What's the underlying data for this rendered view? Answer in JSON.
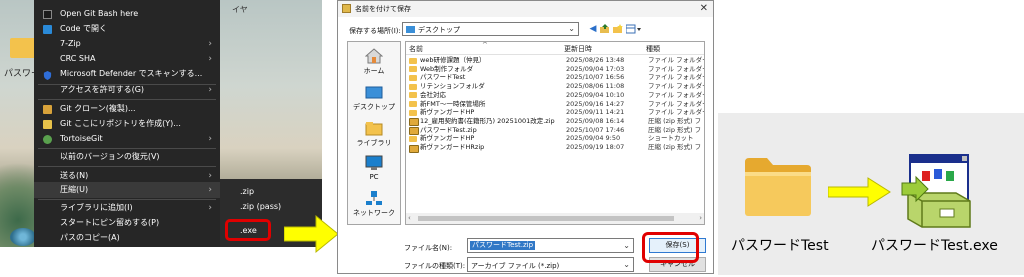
{
  "desktop": {
    "folder_label": "パスワード",
    "top_right_text": "イヤ"
  },
  "context_menu": {
    "items": [
      {
        "label": "Open Git Bash here",
        "icon": "git-bash-icon",
        "arrow": false
      },
      {
        "label": "Code で開く",
        "icon": "vscode-icon",
        "arrow": false
      },
      {
        "label": "7-Zip",
        "icon": "",
        "arrow": true
      },
      {
        "label": "CRC SHA",
        "icon": "",
        "arrow": true
      },
      {
        "label": "Microsoft Defender でスキャンする...",
        "icon": "defender-shield-icon",
        "arrow": false
      },
      {
        "label": "アクセスを許可する(G)",
        "icon": "",
        "arrow": true
      },
      {
        "label": "Git クローン(複製)...",
        "icon": "git-clone-icon",
        "arrow": false
      },
      {
        "label": "Git ここにリポジトリを作成(Y)...",
        "icon": "git-create-icon",
        "arrow": false
      },
      {
        "label": "TortoiseGit",
        "icon": "tortoisegit-icon",
        "arrow": true
      },
      {
        "label": "以前のバージョンの復元(V)",
        "icon": "",
        "arrow": false
      },
      {
        "label": "送る(N)",
        "icon": "",
        "arrow": true
      },
      {
        "label": "圧縮(U)",
        "icon": "",
        "arrow": true
      },
      {
        "label": "ライブラリに追加(I)",
        "icon": "",
        "arrow": true
      },
      {
        "label": "スタートにピン留めする(P)",
        "icon": "",
        "arrow": false
      },
      {
        "label": "パスのコピー(A)",
        "icon": "",
        "arrow": false
      }
    ],
    "submenu": [
      ".zip",
      ".zip (pass)",
      ".exe"
    ]
  },
  "dialog": {
    "title": "名前を付けて保存",
    "save_location_label": "保存する場所(I):",
    "location": "デスクトップ",
    "places": [
      "ホーム",
      "デスクトップ",
      "ライブラリ",
      "PC",
      "ネットワーク"
    ],
    "columns": [
      "名前",
      "更新日時",
      "種類"
    ],
    "files": [
      {
        "name": "web研修課題（仲見）",
        "date": "2025/08/26 13:48",
        "type": "ファイル フォルダー",
        "kind": "folder"
      },
      {
        "name": "Web制作フォルダ",
        "date": "2025/09/04 17:03",
        "type": "ファイル フォルダー",
        "kind": "folder"
      },
      {
        "name": "パスワードTest",
        "date": "2025/10/07 16:56",
        "type": "ファイル フォルダー",
        "kind": "folder"
      },
      {
        "name": "リテンションフォルダ",
        "date": "2025/08/06 11:08",
        "type": "ファイル フォルダー",
        "kind": "folder"
      },
      {
        "name": "会社対応",
        "date": "2025/09/04 10:10",
        "type": "ファイル フォルダー",
        "kind": "folder"
      },
      {
        "name": "新FMT～一時保管場所",
        "date": "2025/09/16 14:27",
        "type": "ファイル フォルダー",
        "kind": "folder"
      },
      {
        "name": "新ヴァンガードHP",
        "date": "2025/09/11 14:21",
        "type": "ファイル フォルダー",
        "kind": "folder"
      },
      {
        "name": "12_雇用契約書(在籍形乃) 20251001改定.zip",
        "date": "2025/09/08 16:14",
        "type": "圧縮 (zip 形式) フ",
        "kind": "zip"
      },
      {
        "name": "パスワードTest.zip",
        "date": "2025/10/07 17:46",
        "type": "圧縮 (zip 形式) フ",
        "kind": "zip"
      },
      {
        "name": "新ヴァンガードHP",
        "date": "2025/09/04 9:50",
        "type": "ショートカット",
        "kind": "shortcut"
      },
      {
        "name": "新ヴァンガードHRzip",
        "date": "2025/09/19 18:07",
        "type": "圧縮 (zip 形式) フ",
        "kind": "zip"
      }
    ],
    "filename_label": "ファイル名(N):",
    "filename_value": "パスワードTest.zip",
    "filetype_label": "ファイルの種類(T):",
    "filetype_value": "アーカイブ ファイル (*.zip)",
    "save_button": "保存(S)",
    "cancel_button": "キャンセル"
  },
  "result": {
    "folder_label": "パスワードTest",
    "exe_label": "パスワードTest.exe"
  },
  "colors": {
    "highlight": "#e00000",
    "arrow": "#ffff00",
    "folder": "#f3c24c"
  }
}
